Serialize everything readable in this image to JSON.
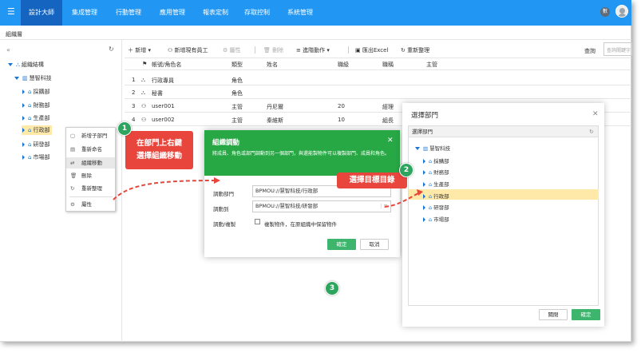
{
  "topbar": {
    "menu_icon": "menu-icon",
    "nav": [
      "設計大師",
      "集成管理",
      "行動管理",
      "應用管理",
      "報表定制",
      "存取控制",
      "系統管理"
    ],
    "active": 0,
    "badge": "數"
  },
  "breadcrumb": "組織層",
  "sidebar": {
    "tree": [
      {
        "label": "組織結構",
        "icon": "org-icon"
      },
      {
        "label": "慧智科技",
        "icon": "building-icon"
      },
      {
        "label": "採購部",
        "icon": "home-icon"
      },
      {
        "label": "財務部",
        "icon": "home-icon"
      },
      {
        "label": "生產部",
        "icon": "home-icon"
      },
      {
        "label": "行政部",
        "icon": "home-icon",
        "selected": true
      },
      {
        "label": "研發部",
        "icon": "home-icon"
      },
      {
        "label": "市場部",
        "icon": "home-icon"
      }
    ]
  },
  "context_menu": {
    "items": [
      "新增子部門",
      "重新命名",
      "組織移動",
      "刪除",
      "重新整理",
      "屬性"
    ],
    "highlighted": 2
  },
  "toolbar": {
    "add": "新增",
    "add_existing": "新增現有員工",
    "properties": "屬性",
    "delete": "刪除",
    "advanced": "進階動作",
    "export": "匯出Excel",
    "refresh": "重新整理",
    "search_label": "查詢",
    "search_placeholder": "查詢關鍵字"
  },
  "table": {
    "headers": [
      "帳號/角色名",
      "類型",
      "姓名",
      "職級",
      "職稱",
      "主管"
    ],
    "rows": [
      {
        "n": "1",
        "account": "行政專員",
        "type": "角色",
        "name": "",
        "level": "",
        "title": ""
      },
      {
        "n": "2",
        "account": "秘書",
        "type": "角色",
        "name": "",
        "level": "",
        "title": ""
      },
      {
        "n": "3",
        "account": "user001",
        "type": "主管",
        "name": "丹尼爾",
        "level": "20",
        "title": "經理"
      },
      {
        "n": "4",
        "account": "user002",
        "type": "主管",
        "name": "秦維斯",
        "level": "10",
        "title": "組長"
      }
    ]
  },
  "move_dialog": {
    "title": "組織調動",
    "description": "將成員、角色或部門調動到另一個部門，與還能製物件可以複製部門、成員和角色。",
    "from_label": "調動部門",
    "from_value": "BPMOU://慧智科技/行政部",
    "to_label": "調動到",
    "to_value": "BPMOU://慧智科技/研發部",
    "mode_label": "調動/複製",
    "checkbox_label": "複製物件，在原組織中保留物件",
    "ok": "確定",
    "cancel": "取消"
  },
  "picker": {
    "title": "選擇部門",
    "panel_header": "選擇部門",
    "tree": [
      {
        "label": "慧智科技"
      },
      {
        "label": "採購部"
      },
      {
        "label": "財務部"
      },
      {
        "label": "生產部"
      },
      {
        "label": "行政部",
        "selected": true
      },
      {
        "label": "研發部"
      },
      {
        "label": "市場部"
      }
    ],
    "close": "關閉",
    "ok": "確定"
  },
  "annotations": {
    "step1_line1": "在部門上右鍵",
    "step1_line2": "選擇組織移動",
    "step2": "選擇目標目錄",
    "num1": "1",
    "num2": "2",
    "num3": "3"
  },
  "colors": {
    "topbar": "#2196f3",
    "dialog_header": "#28a745",
    "callout": "#e8453c",
    "selection": "#ffe9a8",
    "step_badge": "#2ea55f"
  }
}
